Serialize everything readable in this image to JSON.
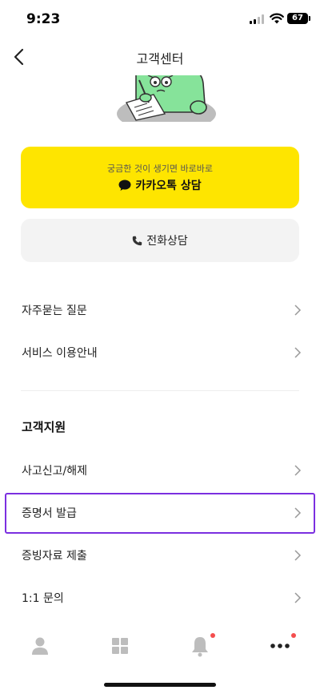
{
  "status": {
    "time": "9:23",
    "battery": "67"
  },
  "nav": {
    "title": "고객센터"
  },
  "kakao": {
    "subtitle": "궁금한 것이 생기면 바로바로",
    "label": "카카오톡 상담",
    "color": "#FEE500"
  },
  "phone": {
    "label": "전화상담"
  },
  "general_items": [
    {
      "label": "자주묻는 질문"
    },
    {
      "label": "서비스 이용안내"
    }
  ],
  "support": {
    "title": "고객지원",
    "items": [
      {
        "label": "사고신고/해제"
      },
      {
        "label": "증명서 발급"
      },
      {
        "label": "증빙자료 제출"
      },
      {
        "label": "1:1 문의"
      }
    ]
  },
  "highlight_color": "#7B2FE0",
  "tabs": [
    {
      "icon": "person-icon"
    },
    {
      "icon": "grid-icon"
    },
    {
      "icon": "bell-icon",
      "badge": true
    },
    {
      "icon": "more-icon",
      "badge": true
    }
  ]
}
